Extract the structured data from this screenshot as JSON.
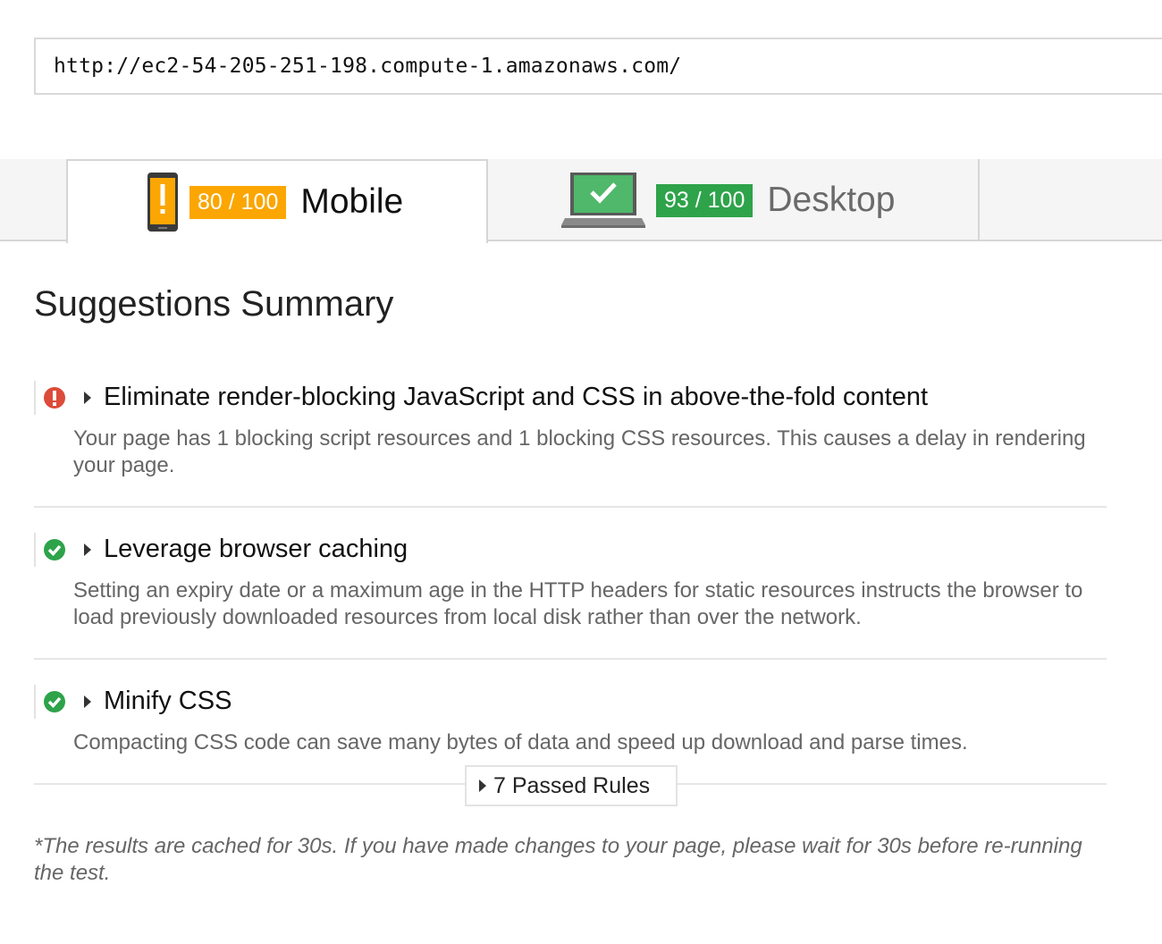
{
  "url_bar": {
    "value": "http://ec2-54-205-251-198.compute-1.amazonaws.com/"
  },
  "tabs": [
    {
      "id": "mobile",
      "icon": "mobile-warning-icon",
      "score": "80 / 100",
      "label": "Mobile",
      "score_color": "#fba602",
      "active": true
    },
    {
      "id": "desktop",
      "icon": "laptop-check-icon",
      "score": "93 / 100",
      "label": "Desktop",
      "score_color": "#2ea34a",
      "active": false
    }
  ],
  "summary": {
    "title": "Suggestions Summary",
    "rules": [
      {
        "status": "error",
        "status_icon": "error-circle-icon",
        "status_color": "#dd4b39",
        "title": "Eliminate render-blocking JavaScript and CSS in above-the-fold content",
        "description": "Your page has 1 blocking script resources and 1 blocking CSS resources. This causes a delay in rendering your page."
      },
      {
        "status": "passed",
        "status_icon": "check-circle-icon",
        "status_color": "#2ea34a",
        "title": "Leverage browser caching",
        "description": "Setting an expiry date or a maximum age in the HTTP headers for static resources instructs the browser to load previously downloaded resources from local disk rather than over the network."
      },
      {
        "status": "passed",
        "status_icon": "check-circle-icon",
        "status_color": "#2ea34a",
        "title": "Minify CSS",
        "description": "Compacting CSS code can save many bytes of data and speed up download and parse times."
      }
    ],
    "passed_rules_label": "7 Passed Rules"
  },
  "footnote": "*The results are cached for 30s. If you have made changes to your page, please wait for 30s before re-running the test."
}
